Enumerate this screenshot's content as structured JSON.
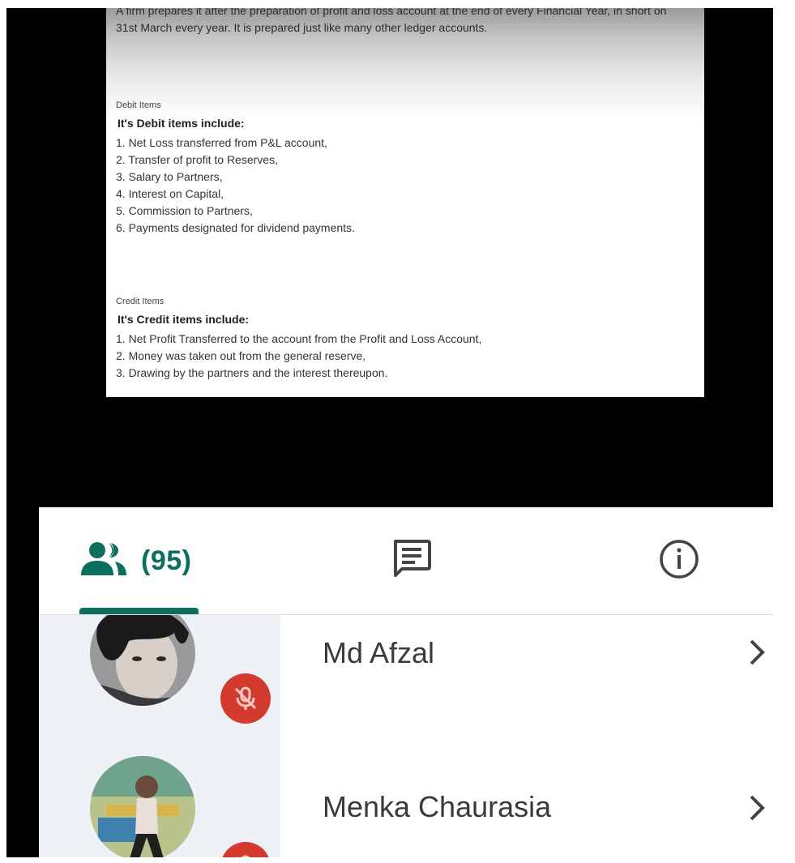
{
  "slide": {
    "intro": "A firm prepares it after the preparation of profit and loss account at the end of every Financial Year, in short on 31st March every year. It is prepared just like many other ledger accounts.",
    "debit": {
      "label": "Debit Items",
      "heading": "It's Debit items include:",
      "items": [
        "1. Net Loss transferred from P&L account,",
        "2. Transfer of profit to Reserves,",
        "3. Salary to Partners,",
        "4. Interest on Capital,",
        "5. Commission to Partners,",
        "6. Payments designated for dividend payments."
      ]
    },
    "credit": {
      "label": "Credit Items",
      "heading": "It's Credit items include:",
      "items": [
        "1. Net Profit Transferred to the account from the Profit and Loss Account,",
        "2. Money was taken out from the general reserve,",
        "3. Drawing by the partners and the interest thereupon."
      ]
    }
  },
  "tabs": {
    "people_count": "(95)",
    "people_icon": "people-icon",
    "chat_icon": "chat-icon",
    "info_icon": "info-icon",
    "active": "people"
  },
  "participants": [
    {
      "name": "Md Afzal",
      "muted": true
    },
    {
      "name": "Menka Chaurasia",
      "muted": true
    }
  ],
  "colors": {
    "accent": "#0b6e5e",
    "muted_badge": "#d23a2e",
    "avatar_zone": "#edf1f6"
  }
}
